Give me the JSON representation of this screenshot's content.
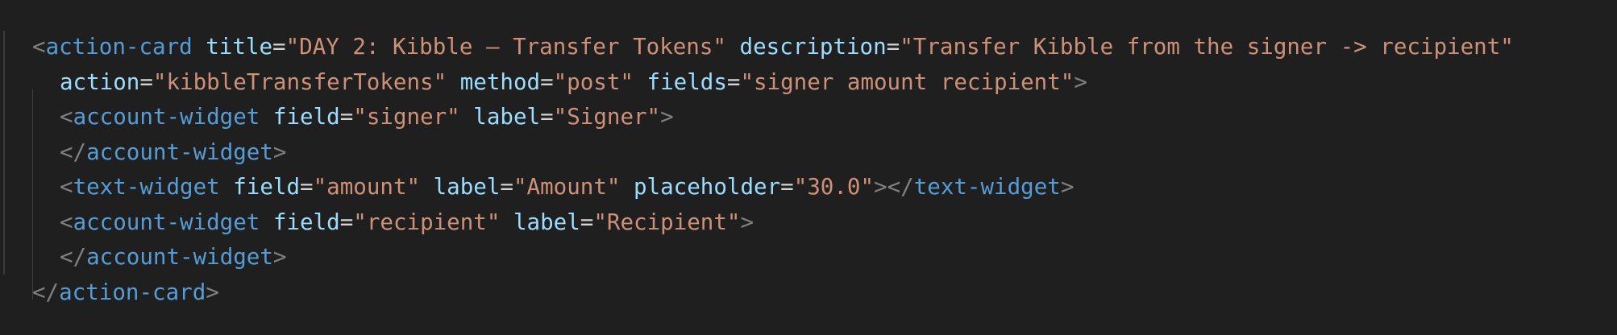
{
  "editor": {
    "background": "#1f1f1f",
    "colors": {
      "tag": "#569cd6",
      "attribute": "#9cdcfe",
      "string": "#ce9178",
      "punctuation": "#808080",
      "text": "#d4d4d4"
    },
    "lines": [
      {
        "indent": 0,
        "tokens": [
          {
            "t": "punct",
            "v": "<"
          },
          {
            "t": "tag",
            "v": "action-card"
          },
          {
            "t": "sp",
            "v": " "
          },
          {
            "t": "attr",
            "v": "title"
          },
          {
            "t": "eq",
            "v": "="
          },
          {
            "t": "str",
            "v": "\"DAY 2: Kibble – Transfer Tokens\""
          },
          {
            "t": "sp",
            "v": " "
          },
          {
            "t": "attr",
            "v": "description"
          },
          {
            "t": "eq",
            "v": "="
          },
          {
            "t": "str",
            "v": "\"Transfer Kibble from the signer -> recipient\""
          }
        ]
      },
      {
        "indent": 1,
        "tokens": [
          {
            "t": "attr",
            "v": "action"
          },
          {
            "t": "eq",
            "v": "="
          },
          {
            "t": "str",
            "v": "\"kibbleTransferTokens\""
          },
          {
            "t": "sp",
            "v": " "
          },
          {
            "t": "attr",
            "v": "method"
          },
          {
            "t": "eq",
            "v": "="
          },
          {
            "t": "str",
            "v": "\"post\""
          },
          {
            "t": "sp",
            "v": " "
          },
          {
            "t": "attr",
            "v": "fields"
          },
          {
            "t": "eq",
            "v": "="
          },
          {
            "t": "str",
            "v": "\"signer amount recipient\""
          },
          {
            "t": "punct",
            "v": ">"
          }
        ]
      },
      {
        "indent": 1,
        "tokens": [
          {
            "t": "punct",
            "v": "<"
          },
          {
            "t": "tag",
            "v": "account-widget"
          },
          {
            "t": "sp",
            "v": " "
          },
          {
            "t": "attr",
            "v": "field"
          },
          {
            "t": "eq",
            "v": "="
          },
          {
            "t": "str",
            "v": "\"signer\""
          },
          {
            "t": "sp",
            "v": " "
          },
          {
            "t": "attr",
            "v": "label"
          },
          {
            "t": "eq",
            "v": "="
          },
          {
            "t": "str",
            "v": "\"Signer\""
          },
          {
            "t": "punct",
            "v": ">"
          }
        ]
      },
      {
        "indent": 1,
        "tokens": [
          {
            "t": "punct",
            "v": "</"
          },
          {
            "t": "tag",
            "v": "account-widget"
          },
          {
            "t": "punct",
            "v": ">"
          }
        ]
      },
      {
        "indent": 1,
        "tokens": [
          {
            "t": "punct",
            "v": "<"
          },
          {
            "t": "tag",
            "v": "text-widget"
          },
          {
            "t": "sp",
            "v": " "
          },
          {
            "t": "attr",
            "v": "field"
          },
          {
            "t": "eq",
            "v": "="
          },
          {
            "t": "str",
            "v": "\"amount\""
          },
          {
            "t": "sp",
            "v": " "
          },
          {
            "t": "attr",
            "v": "label"
          },
          {
            "t": "eq",
            "v": "="
          },
          {
            "t": "str",
            "v": "\"Amount\""
          },
          {
            "t": "sp",
            "v": " "
          },
          {
            "t": "attr",
            "v": "placeholder"
          },
          {
            "t": "eq",
            "v": "="
          },
          {
            "t": "str",
            "v": "\"30.0\""
          },
          {
            "t": "punct",
            "v": "></"
          },
          {
            "t": "tag",
            "v": "text-widget"
          },
          {
            "t": "punct",
            "v": ">"
          }
        ]
      },
      {
        "indent": 1,
        "tokens": [
          {
            "t": "punct",
            "v": "<"
          },
          {
            "t": "tag",
            "v": "account-widget"
          },
          {
            "t": "sp",
            "v": " "
          },
          {
            "t": "attr",
            "v": "field"
          },
          {
            "t": "eq",
            "v": "="
          },
          {
            "t": "str",
            "v": "\"recipient\""
          },
          {
            "t": "sp",
            "v": " "
          },
          {
            "t": "attr",
            "v": "label"
          },
          {
            "t": "eq",
            "v": "="
          },
          {
            "t": "str",
            "v": "\"Recipient\""
          },
          {
            "t": "punct",
            "v": ">"
          }
        ]
      },
      {
        "indent": 1,
        "tokens": [
          {
            "t": "punct",
            "v": "</"
          },
          {
            "t": "tag",
            "v": "account-widget"
          },
          {
            "t": "punct",
            "v": ">"
          }
        ]
      },
      {
        "indent": 0,
        "tokens": [
          {
            "t": "punct",
            "v": "</"
          },
          {
            "t": "tag",
            "v": "action-card"
          },
          {
            "t": "punct",
            "v": ">"
          }
        ]
      }
    ]
  }
}
